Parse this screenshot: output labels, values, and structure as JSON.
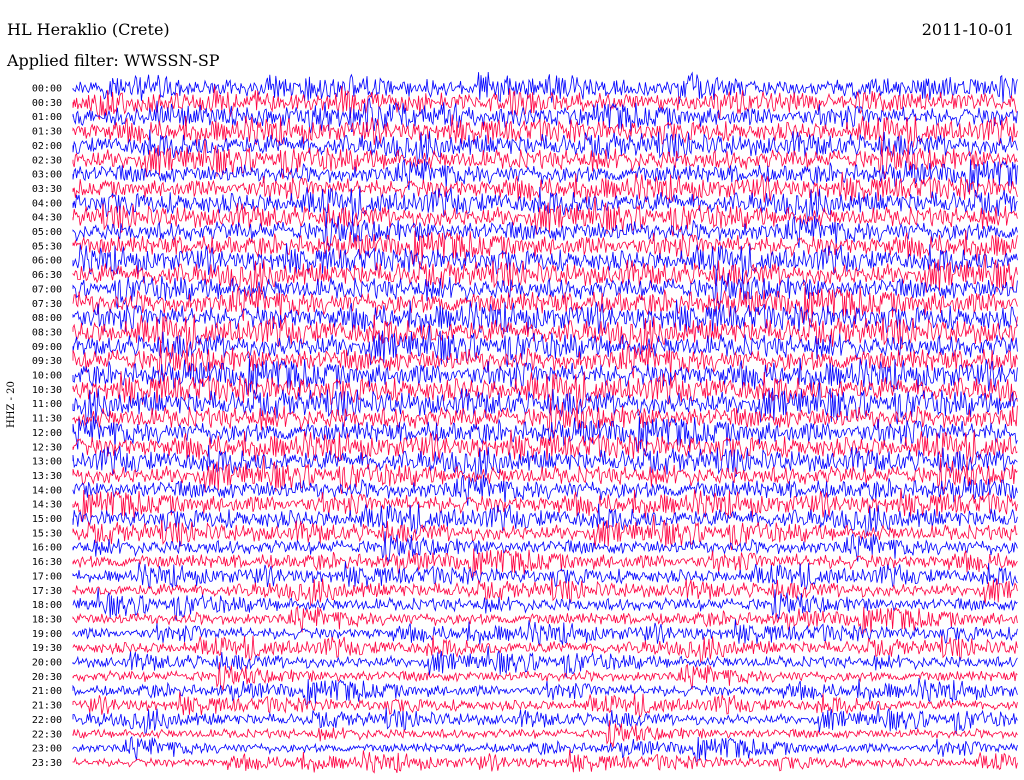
{
  "header": {
    "station": "HL Heraklio (Crete)",
    "date": "2011-10-01",
    "filter": "Applied filter: WWSSN-SP"
  },
  "chart_data": {
    "type": "line",
    "title": "HL Heraklio (Crete)",
    "subtitle": "Applied filter: WWSSN-SP",
    "date": "2011-10-01",
    "ylabel": "HHZ - 20",
    "xlabel": "",
    "trace_interval_minutes": 30,
    "categories": [
      "00:00",
      "00:30",
      "01:00",
      "01:30",
      "02:00",
      "02:30",
      "03:00",
      "03:30",
      "04:00",
      "04:30",
      "05:00",
      "05:30",
      "06:00",
      "06:30",
      "07:00",
      "07:30",
      "08:00",
      "08:30",
      "09:00",
      "09:30",
      "10:00",
      "10:30",
      "11:00",
      "11:30",
      "12:00",
      "12:30",
      "13:00",
      "13:30",
      "14:00",
      "14:30",
      "15:00",
      "15:30",
      "16:00",
      "16:30",
      "17:00",
      "17:30",
      "18:00",
      "18:30",
      "19:00",
      "19:30",
      "20:00",
      "20:30",
      "21:00",
      "21:30",
      "22:00",
      "22:30",
      "23:00",
      "23:30"
    ],
    "colors": [
      "#0000ff",
      "#ff0040"
    ],
    "relative_noise_level": [
      1.1,
      1.2,
      1.3,
      1.3,
      1.4,
      1.4,
      1.3,
      1.3,
      1.4,
      1.4,
      1.4,
      1.4,
      1.4,
      1.5,
      1.5,
      1.6,
      1.6,
      1.6,
      1.6,
      1.6,
      1.6,
      1.6,
      1.6,
      1.5,
      1.5,
      1.4,
      1.4,
      1.3,
      1.3,
      1.2,
      1.2,
      1.1,
      1.0,
      1.0,
      0.9,
      0.9,
      0.9,
      0.85,
      0.8,
      0.8,
      0.8,
      0.75,
      0.75,
      0.7,
      0.7,
      0.65,
      0.65,
      0.6
    ]
  }
}
